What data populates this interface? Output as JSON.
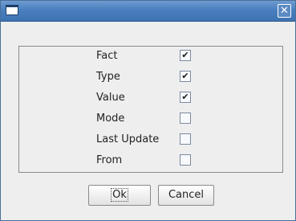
{
  "window": {
    "title": ""
  },
  "fields": [
    {
      "label": "Fact",
      "checked": true
    },
    {
      "label": "Type",
      "checked": true
    },
    {
      "label": "Value",
      "checked": true
    },
    {
      "label": "Mode",
      "checked": false
    },
    {
      "label": "Last Update",
      "checked": false
    },
    {
      "label": "From",
      "checked": false
    }
  ],
  "buttons": {
    "ok": "Ok",
    "cancel": "Cancel"
  },
  "glyphs": {
    "close": "✕",
    "check": "✔"
  },
  "colors": {
    "titlebar": "#4a7fbf",
    "background": "#eeeeee"
  }
}
